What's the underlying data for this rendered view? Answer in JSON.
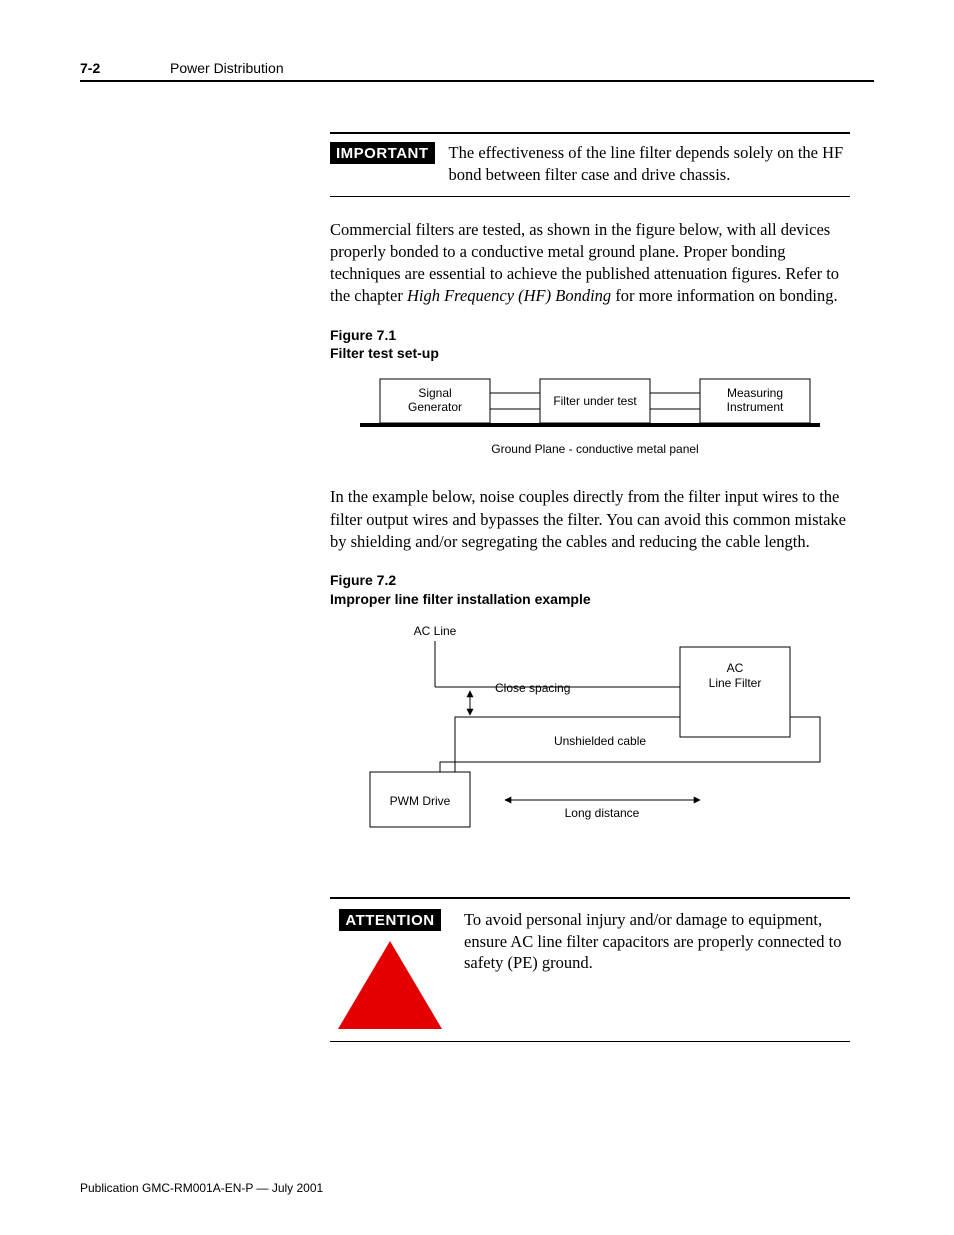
{
  "header": {
    "page_num": "7-2",
    "chapter_title": "Power Distribution"
  },
  "important": {
    "tag": "IMPORTANT",
    "text_a": "The effectiveness of the line filter depends solely on the HF bond between filter case and drive chassis."
  },
  "para1_a": "Commercial filters are tested, as shown in the figure below, with all devices properly bonded to a conductive metal ground plane. Proper bonding techniques are essential to achieve the published attenuation figures. Refer to the chapter ",
  "para1_i": "High Frequency (HF) Bonding",
  "para1_b": " for more information on bonding.",
  "fig1": {
    "caption_a": "Figure 7.1",
    "caption_b": "Filter test set-up",
    "box1": "Signal\nGenerator",
    "box2": "Filter under test",
    "box3": "Measuring\nInstrument",
    "ground_label": "Ground Plane - conductive metal panel"
  },
  "para2": "In the example below, noise couples directly from the filter input wires to the filter output wires and bypasses the filter. You can avoid this common mistake by shielding and/or segregating the cables and reducing the cable length.",
  "fig2": {
    "caption_a": "Figure 7.2",
    "caption_b": "Improper line filter installation example",
    "ac_line": "AC Line",
    "close_spacing": "Close spacing",
    "ac_filter_a": "AC",
    "ac_filter_b": "Line Filter",
    "unshielded": "Unshielded cable",
    "pwm_drive": "PWM Drive",
    "long_distance": "Long distance"
  },
  "attention": {
    "tag": "ATTENTION",
    "text": "To avoid personal injury and/or damage to equipment, ensure AC line filter capacitors are properly connected to safety (PE) ground."
  },
  "footer": "Publication GMC-RM001A-EN-P — July 2001"
}
